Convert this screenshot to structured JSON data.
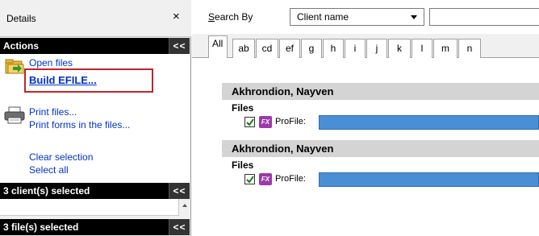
{
  "details": {
    "title": "Details",
    "close_label": "×"
  },
  "sections": {
    "actions": {
      "label": "Actions",
      "collapse": "<<"
    },
    "clients": {
      "label": "3 client(s) selected",
      "collapse": "<<"
    },
    "files": {
      "label": "3 file(s) selected",
      "collapse": "<<"
    }
  },
  "actions": {
    "open_files": "Open files",
    "build_efile": "Build EFILE...",
    "print_files": "Print files...",
    "print_forms": "Print forms in the files...",
    "clear_selection": "Clear selection",
    "select_all": "Select all"
  },
  "search": {
    "label_prefix": "S",
    "label_rest": "earch By",
    "selected": "Client name",
    "input_value": ""
  },
  "tabs": {
    "all": "All",
    "letters": [
      "ab",
      "cd",
      "ef",
      "g",
      "h",
      "i",
      "j",
      "k",
      "l",
      "m",
      "n"
    ]
  },
  "results": [
    {
      "client": "Akhrondion, Nayven",
      "files_label": "Files",
      "file_type": "ProFile:",
      "checked": true
    },
    {
      "client": "Akhrondion, Nayven",
      "files_label": "Files",
      "file_type": "ProFile:",
      "checked": true
    }
  ],
  "colors": {
    "highlight_border": "#c0242c",
    "link": "#0033cc",
    "selection_bar": "#4a8fd6",
    "profile_icon": "#9b3aa8"
  }
}
